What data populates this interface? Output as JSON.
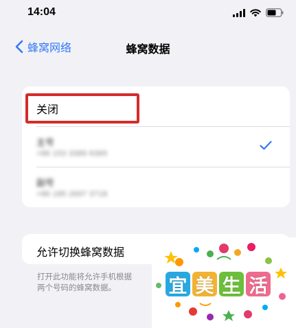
{
  "status_bar": {
    "time": "14:04"
  },
  "nav": {
    "back_label": "蜂窝网络",
    "title": "蜂窝数据"
  },
  "options": {
    "off_label": "关闭",
    "sims": [
      {
        "name": "主号",
        "number": "+86 153 3389 6365",
        "selected": true
      },
      {
        "name": "副号",
        "number": "+86 185 2697 3718",
        "selected": false
      }
    ]
  },
  "switch_row": {
    "label": "允许切换蜂窝数据",
    "enabled": false
  },
  "footnote": {
    "line1": "打开此功能将允许手机根据",
    "line2": "两个号码的蜂窝数据。"
  },
  "watermark": {
    "chars": [
      "宜",
      "美",
      "生",
      "活"
    ]
  },
  "colors": {
    "accent": "#3478f6",
    "highlight_box": "#d52b2b",
    "background": "#f2f2f6"
  }
}
